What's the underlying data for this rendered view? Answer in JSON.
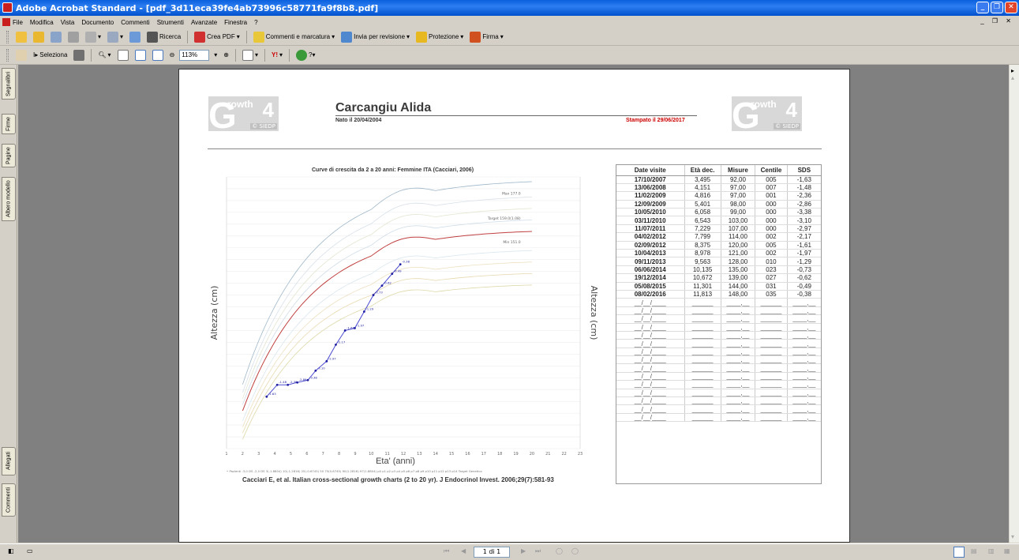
{
  "window": {
    "title": "Adobe Acrobat Standard - [pdf_3d11eca39fe4ab73996c58771fa9f8b8.pdf]"
  },
  "menu": [
    "File",
    "Modifica",
    "Vista",
    "Documento",
    "Commenti",
    "Strumenti",
    "Avanzate",
    "Finestra",
    "?"
  ],
  "toolbar1": {
    "search": "Ricerca",
    "create_pdf": "Crea PDF",
    "comments": "Commenti e marcatura",
    "send_review": "Invia per revisione",
    "protect": "Protezione",
    "sign": "Firma"
  },
  "toolbar2": {
    "select": "Seleziona",
    "zoom": "113%"
  },
  "side_tabs": {
    "bookmarks": "Segnalibri",
    "signatures": "Firme",
    "pages": "Pagine",
    "model": "Albero modello",
    "attachments": "Allegati",
    "comments": "Commenti"
  },
  "status": {
    "page": "1 di 1"
  },
  "doc": {
    "patient": "Carcangiu Alida",
    "born": "Nato il 20/04/2004",
    "printed": "Stampato il 29/06/2017",
    "logo_growth": "rowth",
    "logo_g": "G",
    "logo_4": "4",
    "logo_siedp": "© SIEDP",
    "reference": "Cacciari E, et al. Italian cross-sectional growth charts (2 to 20 yr). J Endocrinol Invest. 2006;29(7):581-93"
  },
  "chart_data": {
    "type": "line",
    "title": "Curve di crescita da 2 a 20 anni: Femmine ITA (Cacciari, 2006)",
    "xlabel": "Eta' (anni)",
    "ylabel": "Altezza (cm)",
    "xlim": [
      1,
      23
    ],
    "ylim": [
      70,
      185
    ],
    "x_ticks": [
      1,
      2,
      3,
      4,
      5,
      6,
      7,
      8,
      9,
      10,
      11,
      12,
      13,
      14,
      15,
      16,
      17,
      18,
      19,
      20,
      21,
      22,
      23
    ],
    "annotations": [
      "Max 177.0",
      "Target 159.0(1.08)",
      "Min 151.0"
    ],
    "legend": "• Pazienti  -3,0 DS  -2,0 DS  3(-1.8804)  10(-1.2816)  25(-0.6745)  50  75(0.6745)  90(1.2816)  97(1.8804)  p0  p1  p2  p3  p4  p5  p6  p7  p8  p9  p10  p11  p12  p13  p14  Target Genetico",
    "series": [
      {
        "name": "Pazienti",
        "x": [
          3.495,
          4.151,
          4.816,
          5.401,
          6.058,
          6.543,
          7.229,
          7.799,
          8.375,
          8.978,
          9.563,
          10.135,
          10.672,
          11.301,
          11.813
        ],
        "y": [
          92,
          97,
          97,
          98,
          99,
          103,
          107,
          114,
          120,
          121,
          128,
          135,
          139,
          144,
          148
        ],
        "labels": [
          "-1.63",
          "-1.48",
          "-2.36",
          "-2.86",
          "-3.38",
          "-3.10",
          "-2.97",
          "-2.17",
          "-1.61",
          "-1.97",
          "-1.29",
          "-0.73",
          "-0.62",
          "-0.49",
          "-0.38"
        ]
      }
    ]
  },
  "visits": {
    "headers": [
      "Date visite",
      "Età dec.",
      "Misure",
      "Centile",
      "SDS"
    ],
    "rows": [
      [
        "17/10/2007",
        "3,495",
        "92,00",
        "005",
        "-1,63"
      ],
      [
        "13/06/2008",
        "4,151",
        "97,00",
        "007",
        "-1,48"
      ],
      [
        "11/02/2009",
        "4,816",
        "97,00",
        "001",
        "-2,36"
      ],
      [
        "12/09/2009",
        "5,401",
        "98,00",
        "000",
        "-2,86"
      ],
      [
        "10/05/2010",
        "6,058",
        "99,00",
        "000",
        "-3,38"
      ],
      [
        "03/11/2010",
        "6,543",
        "103,00",
        "000",
        "-3,10"
      ],
      [
        "11/07/2011",
        "7,229",
        "107,00",
        "000",
        "-2,97"
      ],
      [
        "04/02/2012",
        "7,799",
        "114,00",
        "002",
        "-2,17"
      ],
      [
        "02/09/2012",
        "8,375",
        "120,00",
        "005",
        "-1,61"
      ],
      [
        "10/04/2013",
        "8,978",
        "121,00",
        "002",
        "-1,97"
      ],
      [
        "09/11/2013",
        "9,563",
        "128,00",
        "010",
        "-1,29"
      ],
      [
        "06/06/2014",
        "10,135",
        "135,00",
        "023",
        "-0,73"
      ],
      [
        "19/12/2014",
        "10,672",
        "139,00",
        "027",
        "-0,62"
      ],
      [
        "05/08/2015",
        "11,301",
        "144,00",
        "031",
        "-0,49"
      ],
      [
        "08/02/2016",
        "11,813",
        "148,00",
        "035",
        "-0,38"
      ]
    ],
    "blank_row": [
      "__/__/____",
      "______",
      "____,__",
      "______",
      "____,__"
    ]
  }
}
